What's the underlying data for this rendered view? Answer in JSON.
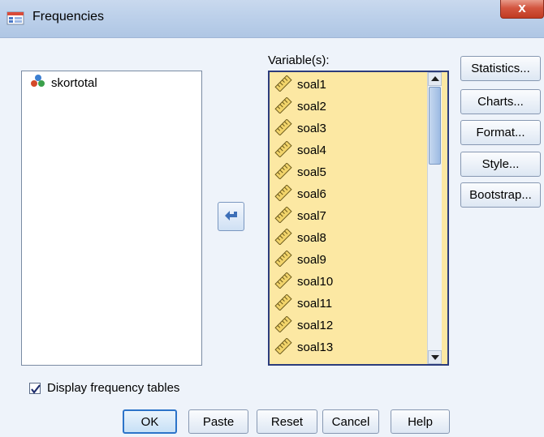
{
  "window": {
    "title": "Frequencies",
    "close_glyph": "x"
  },
  "source_list": {
    "items": [
      {
        "label": "skortotal",
        "icon": "nominal-variable-icon"
      }
    ]
  },
  "variables": {
    "label": "Variable(s):",
    "items": [
      "soal1",
      "soal2",
      "soal3",
      "soal4",
      "soal5",
      "soal6",
      "soal7",
      "soal8",
      "soal9",
      "soal10",
      "soal11",
      "soal12",
      "soal13"
    ],
    "item_icon": "scale-ruler-icon",
    "background": "#fce8a3"
  },
  "move_button": {
    "icon": "arrow-left-icon"
  },
  "side_buttons": [
    "Statistics...",
    "Charts...",
    "Format...",
    "Style...",
    "Bootstrap..."
  ],
  "checkbox": {
    "label": "Display frequency tables",
    "checked": true
  },
  "bottom_buttons": [
    "OK",
    "Paste",
    "Reset",
    "Cancel",
    "Help"
  ]
}
